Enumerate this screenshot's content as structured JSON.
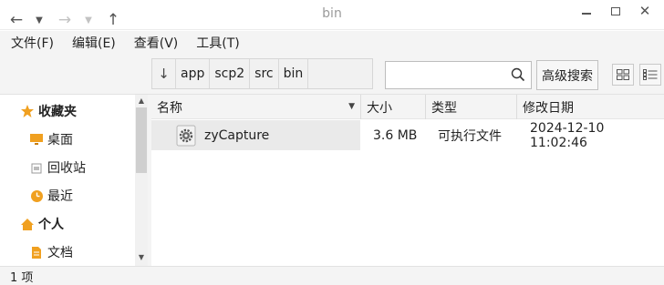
{
  "window": {
    "title": "bin",
    "minimize_glyph": "",
    "maximize_glyph": "",
    "close_glyph": "✕"
  },
  "menu": [
    "文件(F)",
    "编辑(E)",
    "查看(V)",
    "工具(T)"
  ],
  "toolbar": {
    "back_glyph": "←",
    "history_glyph": "▼",
    "forward_glyph": "→",
    "forward_history_glyph": "▼",
    "up_glyph": "↑",
    "expand_glyph": "↓",
    "breadcrumbs": [
      "app",
      "scp2",
      "src",
      "bin"
    ],
    "search_value": "",
    "search_placeholder": "",
    "advanced_search_label": "高级搜索"
  },
  "sidebar": {
    "favorites_label": "收藏夹",
    "favorites": [
      {
        "label": "桌面",
        "icon": "desktop-icon"
      },
      {
        "label": "回收站",
        "icon": "trash-icon"
      },
      {
        "label": "最近",
        "icon": "clock-icon"
      }
    ],
    "personal_label": "个人",
    "personal": [
      {
        "label": "文档",
        "icon": "document-icon"
      }
    ],
    "scroll_up_glyph": "▲",
    "scroll_down_glyph": "▼"
  },
  "columns": {
    "name": "名称",
    "size": "大小",
    "type": "类型",
    "modified": "修改日期",
    "sort_glyph": "▼"
  },
  "files": [
    {
      "name": "zyCapture",
      "size": "3.6 MB",
      "type": "可执行文件",
      "modified": "2024-12-10 11:02:46",
      "icon": "executable-gear-icon"
    }
  ],
  "status": {
    "item_count": "1 项"
  },
  "colors": {
    "accent_orange": "#f0a020",
    "selection_bg": "#eaeaea"
  }
}
